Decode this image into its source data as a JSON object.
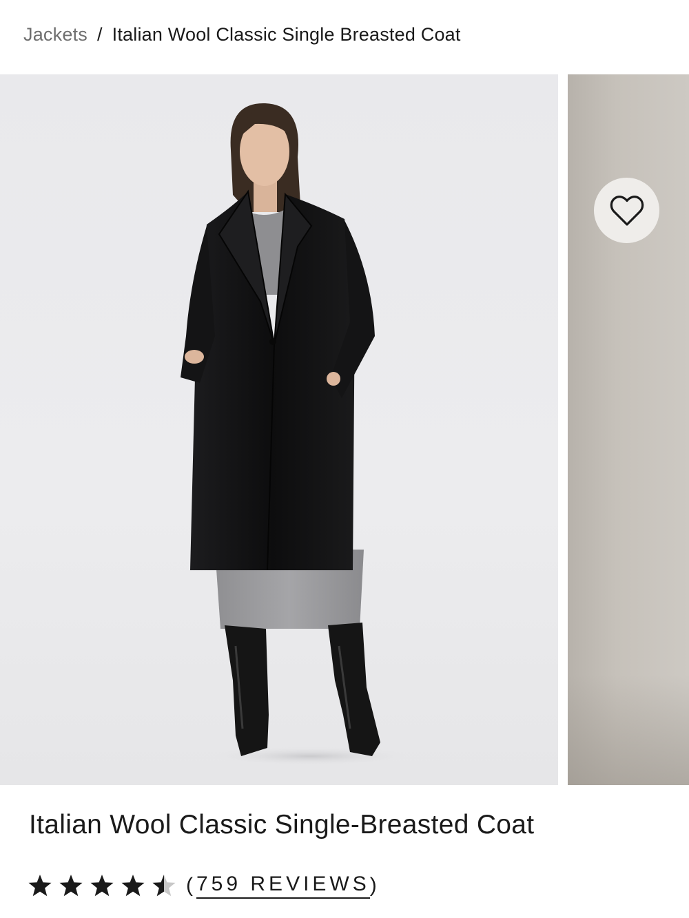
{
  "breadcrumb": {
    "parent": "Jackets",
    "separator": "/",
    "current": "Italian Wool Classic Single Breasted Coat"
  },
  "gallery": {
    "favorite_icon": "heart-outline-icon"
  },
  "product": {
    "title": "Italian Wool Classic Single-Breasted Coat",
    "rating": 4.5,
    "rating_max": 5,
    "reviews_open": "(",
    "reviews_text": "759 REVIEWS",
    "reviews_close": ")"
  },
  "colors": {
    "text": "#1a1a1a",
    "muted": "#6f6f6f",
    "star": "#1a1a1a",
    "star_empty": "#c8c8c8",
    "coat": "#121212",
    "sweater": "#9a9a9c"
  }
}
